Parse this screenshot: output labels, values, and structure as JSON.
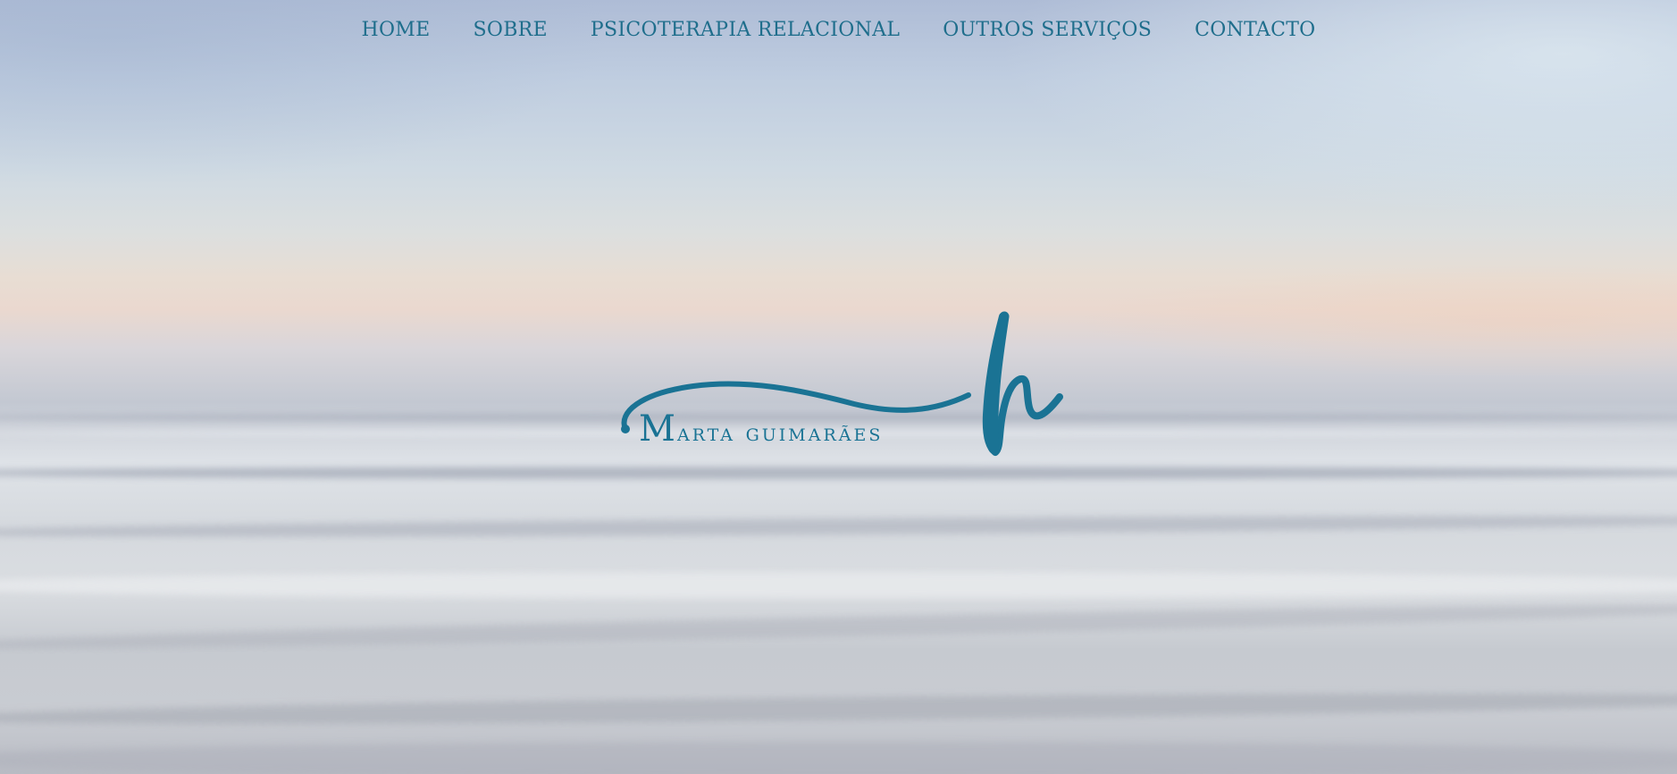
{
  "nav": {
    "items": [
      {
        "label": "HOME"
      },
      {
        "label": "SOBRE"
      },
      {
        "label": "PSICOTERAPIA RELACIONAL"
      },
      {
        "label": "OUTROS SERVIÇOS"
      },
      {
        "label": "CONTACTO"
      }
    ]
  },
  "logo": {
    "initial": "M",
    "rest": "arta guimarães"
  },
  "colors": {
    "accent": "#1a7394",
    "nav_text": "#1f6e8c"
  }
}
